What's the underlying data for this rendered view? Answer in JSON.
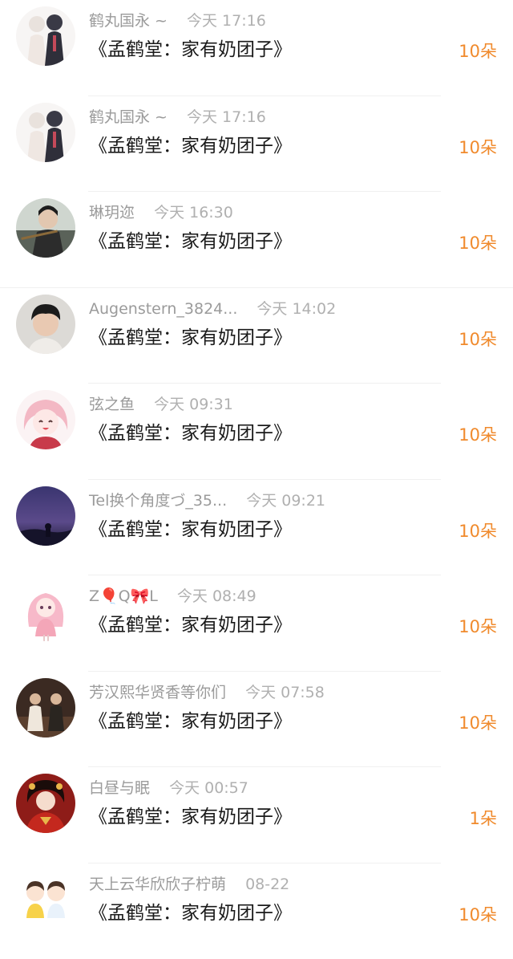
{
  "items": [
    {
      "name": "鹤丸国永 ~",
      "time": "今天 17:16",
      "message": "《孟鹤堂：家有奶团子》",
      "count": "10朵",
      "avatar_icon": "anime-duo-avatar"
    },
    {
      "name": "鹤丸国永 ~",
      "time": "今天 17:16",
      "message": "《孟鹤堂：家有奶团子》",
      "count": "10朵",
      "avatar_icon": "anime-duo-avatar"
    },
    {
      "name": "琳玥迩",
      "time": "今天 16:30",
      "message": "《孟鹤堂：家有奶团子》",
      "count": "10朵",
      "avatar_icon": "flute-player-avatar"
    },
    {
      "name": "Augenstern_3824...",
      "time": "今天 14:02",
      "message": "《孟鹤堂：家有奶团子》",
      "count": "10朵",
      "avatar_icon": "boy-portrait-avatar"
    },
    {
      "name": "弦之鱼",
      "time": "今天 09:31",
      "message": "《孟鹤堂：家有奶团子》",
      "count": "10朵",
      "avatar_icon": "pink-anime-girl-avatar"
    },
    {
      "name": "Tel换个角度づ_35...",
      "time": "今天 09:21",
      "message": "《孟鹤堂：家有奶团子》",
      "count": "10朵",
      "avatar_icon": "night-sky-avatar"
    },
    {
      "name": "Z🎈Q🎀L",
      "time": "今天 08:49",
      "message": "《孟鹤堂：家有奶团子》",
      "count": "10朵",
      "avatar_icon": "pink-chibi-avatar"
    },
    {
      "name": "芳汉熙华贤香等你们",
      "time": "今天 07:58",
      "message": "《孟鹤堂：家有奶团子》",
      "count": "10朵",
      "avatar_icon": "stage-duo-avatar"
    },
    {
      "name": "白昼与眠",
      "time": "今天 00:57",
      "message": "《孟鹤堂：家有奶团子》",
      "count": "1朵",
      "avatar_icon": "red-costume-avatar"
    },
    {
      "name": "天上云华欣欣子柠萌",
      "time": "08-22",
      "message": "《孟鹤堂：家有奶团子》",
      "count": "10朵",
      "avatar_icon": "cartoon-kids-avatar"
    }
  ],
  "colors": {
    "accent": "#f08a2c",
    "meta_text": "#9b9b9b",
    "message_text": "#1a1a1a",
    "divider": "#f0f0f0"
  }
}
